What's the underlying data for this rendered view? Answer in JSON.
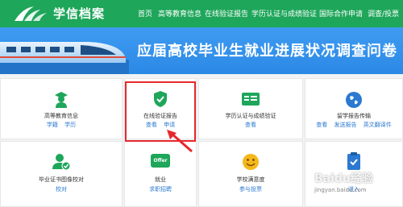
{
  "header": {
    "brand": "学信档案",
    "nav": [
      "首页",
      "高等教育信息",
      "在线验证报告",
      "学历认证与成绩验证",
      "国际合作申请",
      "调查/投票"
    ]
  },
  "banner": {
    "title": "应届高校毕业生就业进展状况调查问卷"
  },
  "cards": [
    {
      "title": "高等教育信息",
      "links": [
        "学籍",
        "学历"
      ],
      "icon": "graduate-icon"
    },
    {
      "title": "在线验证报告",
      "links": [
        "查看",
        "申请"
      ],
      "icon": "shield-check-icon"
    },
    {
      "title": "学历认证与成绩验证",
      "links": [
        "查看"
      ],
      "icon": "id-card-icon"
    },
    {
      "title": "留学报告传输",
      "links": [
        "查看",
        "发送报告",
        "英文翻译件"
      ],
      "icon": "globe-icon"
    },
    {
      "title": "毕业证书图像校对",
      "links": [
        "校对"
      ],
      "icon": "user-check-icon"
    },
    {
      "title": "就业",
      "links": [
        "求职招聘"
      ],
      "icon": "offer-icon",
      "badge": "Offer"
    },
    {
      "title": "学校满意度",
      "links": [
        "参与投票"
      ],
      "icon": "smiley-icon"
    },
    {
      "title": "",
      "links": [
        "进入"
      ],
      "icon": "clipboard-check-icon"
    }
  ],
  "watermark": {
    "text": "Baidu经验",
    "sub": "jingyan.baidu.com"
  },
  "colors": {
    "header": "#1ea65a",
    "banner": "#2b89e6",
    "link": "#2b79d0",
    "highlight": "#e6282c"
  }
}
